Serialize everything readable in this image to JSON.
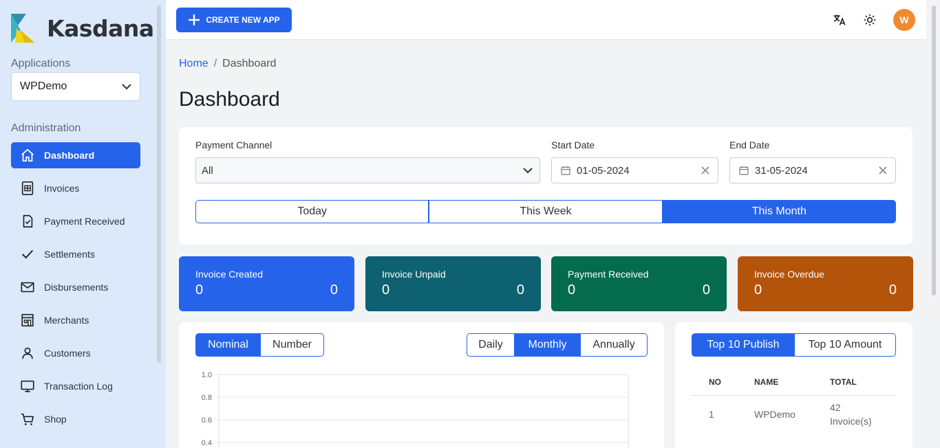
{
  "app": {
    "name": "Kasdana"
  },
  "sidebar": {
    "applications_label": "Applications",
    "app_select_value": "WPDemo",
    "administration_label": "Administration",
    "items": [
      {
        "label": "Dashboard",
        "icon": "home-icon",
        "active": true
      },
      {
        "label": "Invoices",
        "icon": "invoice-icon"
      },
      {
        "label": "Payment Received",
        "icon": "document-check-icon"
      },
      {
        "label": "Settlements",
        "icon": "check-icon"
      },
      {
        "label": "Disbursements",
        "icon": "mail-icon"
      },
      {
        "label": "Merchants",
        "icon": "store-icon"
      },
      {
        "label": "Customers",
        "icon": "user-icon"
      },
      {
        "label": "Transaction Log",
        "icon": "monitor-icon"
      },
      {
        "label": "Shop",
        "icon": "cart-icon"
      }
    ]
  },
  "topbar": {
    "create_label": "CREATE NEW APP",
    "avatar_initial": "W"
  },
  "breadcrumb": {
    "home": "Home",
    "current": "Dashboard"
  },
  "page_title": "Dashboard",
  "filters": {
    "payment_channel_label": "Payment Channel",
    "payment_channel_value": "All",
    "start_date_label": "Start Date",
    "start_date_value": "01-05-2024",
    "end_date_label": "End Date",
    "end_date_value": "31-05-2024",
    "periods": [
      "Today",
      "This Week",
      "This Month"
    ],
    "active_period": "This Month"
  },
  "stats": [
    {
      "label": "Invoice Created",
      "left_value": "0",
      "right_value": "0",
      "color": "#2563eb"
    },
    {
      "label": "Invoice Unpaid",
      "left_value": "0",
      "right_value": "0",
      "color": "#0e6170"
    },
    {
      "label": "Payment Received",
      "left_value": "0",
      "right_value": "0",
      "color": "#046b4d"
    },
    {
      "label": "Invoice Overdue",
      "left_value": "0",
      "right_value": "0",
      "color": "#b4530a"
    }
  ],
  "chart_controls": {
    "metric_tabs": [
      "Nominal",
      "Number"
    ],
    "active_metric": "Nominal",
    "range_tabs": [
      "Daily",
      "Monthly",
      "Annually"
    ],
    "active_range": "Monthly"
  },
  "chart_data": {
    "type": "line",
    "title": "",
    "xlabel": "",
    "ylabel": "",
    "ylim": [
      0,
      1.0
    ],
    "y_ticks": [
      "1.0",
      "0.8",
      "0.6",
      "0.4"
    ],
    "series": [],
    "grid": true
  },
  "top10": {
    "tabs": [
      "Top 10 Publish",
      "Top 10 Amount"
    ],
    "active_tab": "Top 10 Publish",
    "columns": [
      "NO",
      "NAME",
      "TOTAL"
    ],
    "rows": [
      {
        "no": "1",
        "name": "WPDemo",
        "total_line1": "42",
        "total_line2": "Invoice(s)"
      }
    ]
  }
}
